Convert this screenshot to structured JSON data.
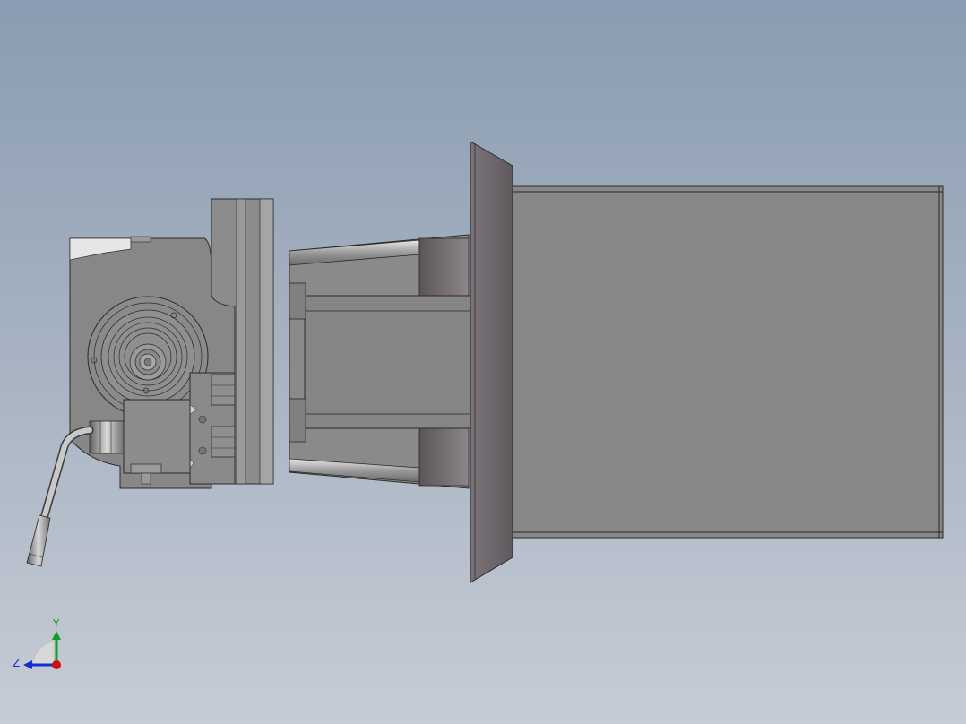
{
  "viewport": {
    "background_top": "#8a9cb1",
    "background_bottom": "#c6ccd6"
  },
  "triad": {
    "axis_y_label": "Y",
    "axis_z_label": "Z",
    "x_color": "#d01010",
    "y_color": "#10a020",
    "z_color": "#1030d0"
  }
}
